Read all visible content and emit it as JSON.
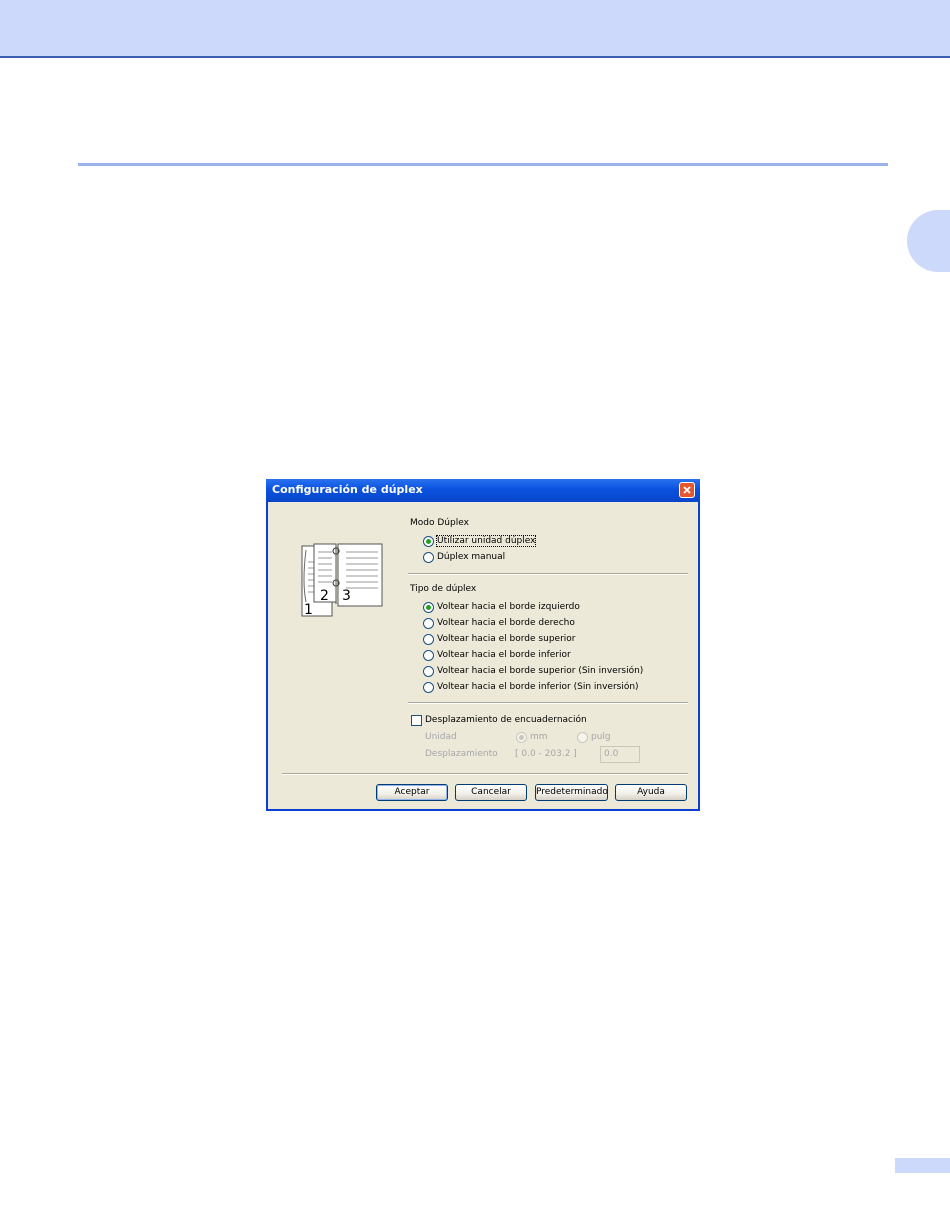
{
  "dialog": {
    "title": "Configuración de dúplex",
    "preview": {
      "page_numbers": [
        "1",
        "2",
        "3"
      ]
    },
    "duplex_mode": {
      "label": "Modo Dúplex",
      "options": [
        {
          "label": "Utilizar unidad dúplex",
          "selected": true
        },
        {
          "label": "Dúplex manual",
          "selected": false
        }
      ]
    },
    "duplex_type": {
      "label": "Tipo de dúplex",
      "options": [
        {
          "label": "Voltear hacia el borde izquierdo",
          "selected": true
        },
        {
          "label": "Voltear hacia el borde derecho",
          "selected": false
        },
        {
          "label": "Voltear hacia el borde superior",
          "selected": false
        },
        {
          "label": "Voltear hacia el borde inferior",
          "selected": false
        },
        {
          "label": "Voltear hacia el borde superior (Sin inversión)",
          "selected": false
        },
        {
          "label": "Voltear hacia el borde inferior (Sin inversión)",
          "selected": false
        }
      ]
    },
    "binding_offset": {
      "checkbox_label": "Desplazamiento de encuadernación",
      "checked": false,
      "unit_label": "Unidad",
      "unit_options": [
        {
          "label": "mm",
          "selected": true
        },
        {
          "label": "pulg",
          "selected": false
        }
      ],
      "offset_label": "Desplazamiento",
      "range": "[ 0.0 - 203.2 ]",
      "value": "0.0"
    },
    "buttons": {
      "ok": "Aceptar",
      "cancel": "Cancelar",
      "default": "Predeterminado",
      "help": "Ayuda"
    }
  },
  "colors": {
    "header_band": "#cdd9fb",
    "accent_rule": "#9bb3ec",
    "titlebar": "#0a52df",
    "dialog_face": "#ece9d8"
  }
}
